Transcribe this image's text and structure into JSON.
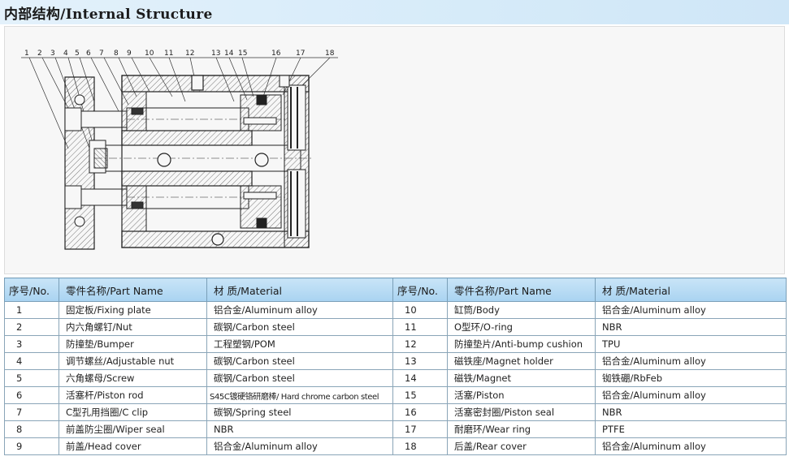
{
  "header": {
    "title": "内部结构/Internal Structure"
  },
  "diagram": {
    "callouts": [
      "1",
      "2",
      "3",
      "4",
      "5",
      "6",
      "7",
      "8",
      "9",
      "10",
      "11",
      "12",
      "13",
      "14",
      "15",
      "16",
      "17",
      "18"
    ]
  },
  "table": {
    "columns": [
      "序号/No.",
      "零件名称/Part Name",
      "材 质/Material",
      "序号/No.",
      "零件名称/Part Name",
      "材 质/Material"
    ],
    "rows": [
      {
        "left": {
          "no": "1",
          "name": "固定板/Fixing plate",
          "material": "铝合金/Aluminum alloy"
        },
        "right": {
          "no": "10",
          "name": "缸筒/Body",
          "material": "铝合金/Aluminum alloy"
        }
      },
      {
        "left": {
          "no": "2",
          "name": "内六角螺钉/Nut",
          "material": "碳钢/Carbon steel"
        },
        "right": {
          "no": "11",
          "name": "O型环/O-ring",
          "material": "NBR"
        }
      },
      {
        "left": {
          "no": "3",
          "name": "防撞垫/Bumper",
          "material": "工程塑钢/POM"
        },
        "right": {
          "no": "12",
          "name": "防撞垫片/Anti-bump cushion",
          "material": "TPU"
        }
      },
      {
        "left": {
          "no": "4",
          "name": "调节螺丝/Adjustable nut",
          "material": "碳钢/Carbon steel"
        },
        "right": {
          "no": "13",
          "name": "磁铁座/Magnet holder",
          "material": "铝合金/Aluminum alloy"
        }
      },
      {
        "left": {
          "no": "5",
          "name": "六角螺母/Screw",
          "material": "碳钢/Carbon steel"
        },
        "right": {
          "no": "14",
          "name": "磁铁/Magnet",
          "material": "铷铁硼/RbFeb"
        }
      },
      {
        "left": {
          "no": "6",
          "name": "活塞杆/Piston rod",
          "material": "S45C镀硬铬研磨棒/ Hard chrome carbon steel"
        },
        "right": {
          "no": "15",
          "name": "活塞/Piston",
          "material": "铝合金/Aluminum alloy"
        }
      },
      {
        "left": {
          "no": "7",
          "name": "C型孔用挡圈/C clip",
          "material": "碳钢/Spring steel"
        },
        "right": {
          "no": "16",
          "name": "活塞密封圈/Piston seal",
          "material": "NBR"
        }
      },
      {
        "left": {
          "no": "8",
          "name": "前盖防尘圈/Wiper seal",
          "material": "NBR"
        },
        "right": {
          "no": "17",
          "name": "耐磨环/Wear ring",
          "material": "PTFE"
        }
      },
      {
        "left": {
          "no": "9",
          "name": "前盖/Head cover",
          "material": "铝合金/Aluminum alloy"
        },
        "right": {
          "no": "18",
          "name": "后盖/Rear cover",
          "material": "铝合金/Aluminum alloy"
        }
      }
    ]
  }
}
